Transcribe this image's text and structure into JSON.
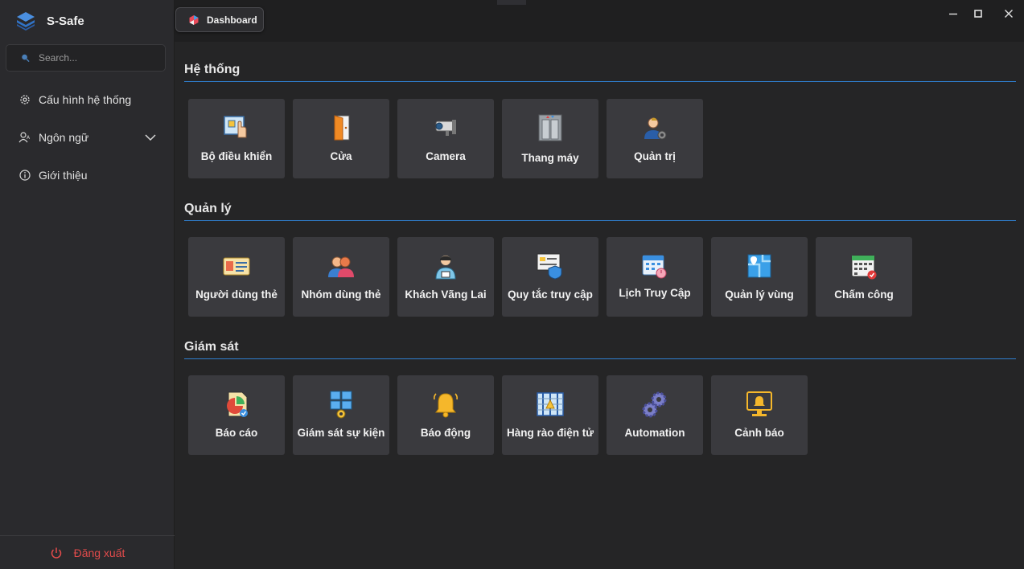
{
  "app": {
    "name": "S-Safe"
  },
  "search": {
    "placeholder": "Search..."
  },
  "sidebar": {
    "items": [
      {
        "label": "Cấu hình hệ thống",
        "icon": "gear-icon"
      },
      {
        "label": "Ngôn ngữ",
        "icon": "language-icon"
      },
      {
        "label": "Giới thiệu",
        "icon": "info-icon"
      }
    ],
    "logout_label": "Đăng xuất"
  },
  "tab": {
    "label": "Dashboard"
  },
  "sections": [
    {
      "title": "Hệ thống",
      "tiles": [
        {
          "label": "Bộ điều khiển",
          "icon": "controller-icon"
        },
        {
          "label": "Cửa",
          "icon": "door-icon"
        },
        {
          "label": "Camera",
          "icon": "camera-icon"
        },
        {
          "label": "Thang máy",
          "icon": "elevator-icon"
        },
        {
          "label": "Quản trị",
          "icon": "admin-icon"
        }
      ]
    },
    {
      "title": "Quản lý",
      "tiles": [
        {
          "label": "Người dùng thẻ",
          "icon": "id-card-icon"
        },
        {
          "label": "Nhóm dùng thẻ",
          "icon": "user-group-icon"
        },
        {
          "label": "Khách Vãng Lai",
          "icon": "visitor-icon"
        },
        {
          "label": "Quy tắc truy cập",
          "icon": "access-rule-icon"
        },
        {
          "label": "Lịch Truy Cập",
          "icon": "calendar-clock-icon"
        },
        {
          "label": "Quản lý vùng",
          "icon": "map-zone-icon"
        },
        {
          "label": "Chấm công",
          "icon": "attendance-calendar-icon"
        }
      ]
    },
    {
      "title": "Giám sát",
      "tiles": [
        {
          "label": "Báo cáo",
          "icon": "report-icon"
        },
        {
          "label": "Giám sát sự kiện",
          "icon": "event-monitor-icon"
        },
        {
          "label": "Báo động",
          "icon": "bell-icon"
        },
        {
          "label": "Hàng rào điện tử",
          "icon": "electric-fence-icon"
        },
        {
          "label": "Automation",
          "icon": "gears-icon"
        },
        {
          "label": "Cảnh báo",
          "icon": "warning-monitor-icon"
        }
      ]
    }
  ],
  "colors": {
    "accent": "#2f7fcf",
    "logout": "#e24b4b",
    "tile": "#3a3a3e"
  }
}
